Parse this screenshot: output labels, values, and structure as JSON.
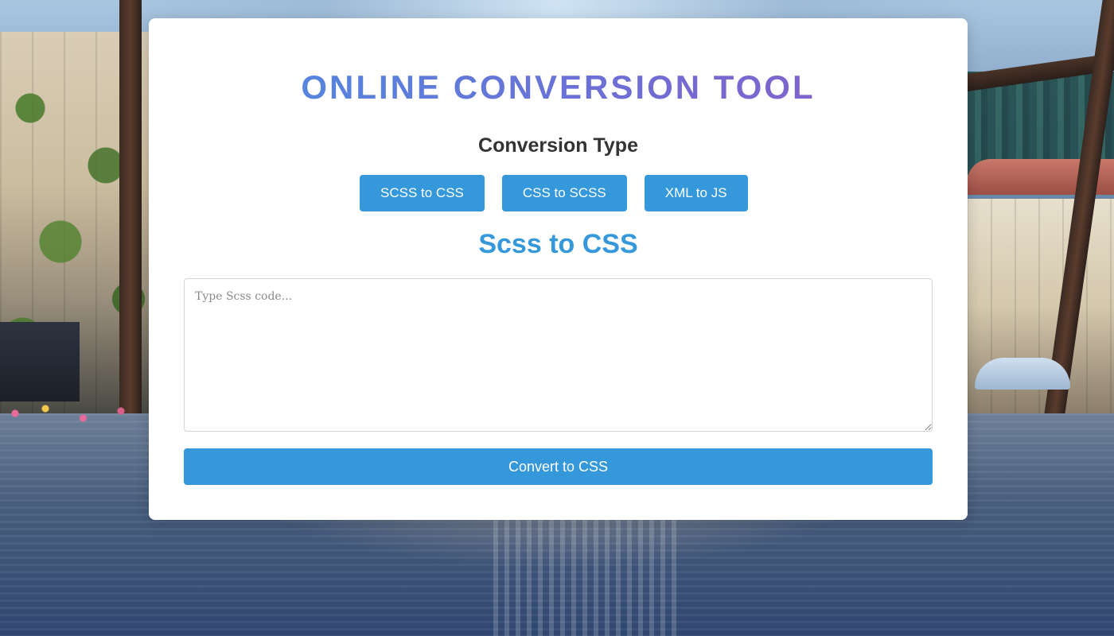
{
  "header": {
    "title": "ONLINE CONVERSION TOOL",
    "subtitle": "Conversion Type"
  },
  "conversion_types": [
    {
      "label": "SCSS to CSS"
    },
    {
      "label": "CSS to SCSS"
    },
    {
      "label": "XML to JS"
    }
  ],
  "converter": {
    "section_title": "Scss to CSS",
    "input_placeholder": "Type Scss code...",
    "input_value": "",
    "convert_label": "Convert to CSS"
  },
  "colors": {
    "accent": "#3498db",
    "title_gradient_start": "#4a90e2",
    "title_gradient_end": "#8e5cc6",
    "card_background": "#ffffff"
  }
}
